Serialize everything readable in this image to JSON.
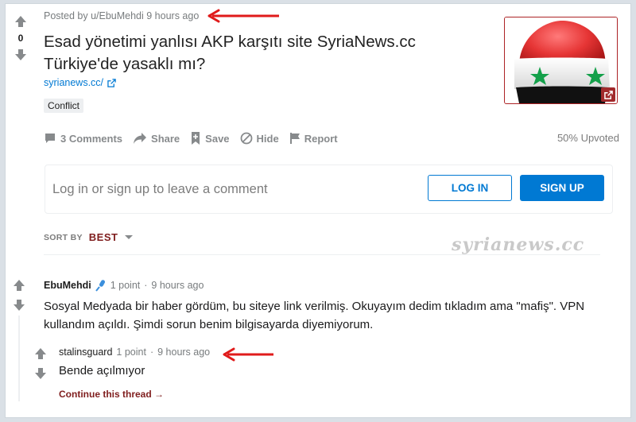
{
  "post": {
    "score": "0",
    "posted_by": "Posted by u/EbuMehdi 9 hours ago",
    "title": "Esad yönetimi yanlısı AKP karşıtı site SyriaNews.cc Türkiye'de yasaklı mı?",
    "domain": "syrianews.cc/",
    "flair": "Conflict",
    "upvoted": "50% Upvoted"
  },
  "actions": {
    "comments": "3 Comments",
    "share": "Share",
    "save": "Save",
    "hide": "Hide",
    "report": "Report"
  },
  "comment_box": {
    "prompt": "Log in or sign up to leave a comment",
    "login": "LOG IN",
    "signup": "SIGN UP"
  },
  "sort": {
    "label": "SORT BY",
    "value": "BEST"
  },
  "watermark": "syrianews.cc",
  "comments": [
    {
      "author": "EbuMehdi",
      "points": "1 point",
      "sep": "·",
      "time": "9 hours ago",
      "body": "Sosyal Medyada bir haber gördüm, bu siteye link verilmiş. Okuyayım dedim tıkladım ama \"mafiş\". VPN kullandım açıldı. Şimdi sorun benim bilgisayarda diyemiyorum."
    },
    {
      "author": "stalinsguard",
      "points": "1 point",
      "sep": "·",
      "time": "9 hours ago",
      "body": "Bende açılmıyor"
    }
  ],
  "continue_thread": "Continue this thread →",
  "colors": {
    "accent": "#0079d3",
    "annotation_arrow": "#e01b1b",
    "thumb_red": "#e63535",
    "thumb_green": "#14a04a"
  }
}
